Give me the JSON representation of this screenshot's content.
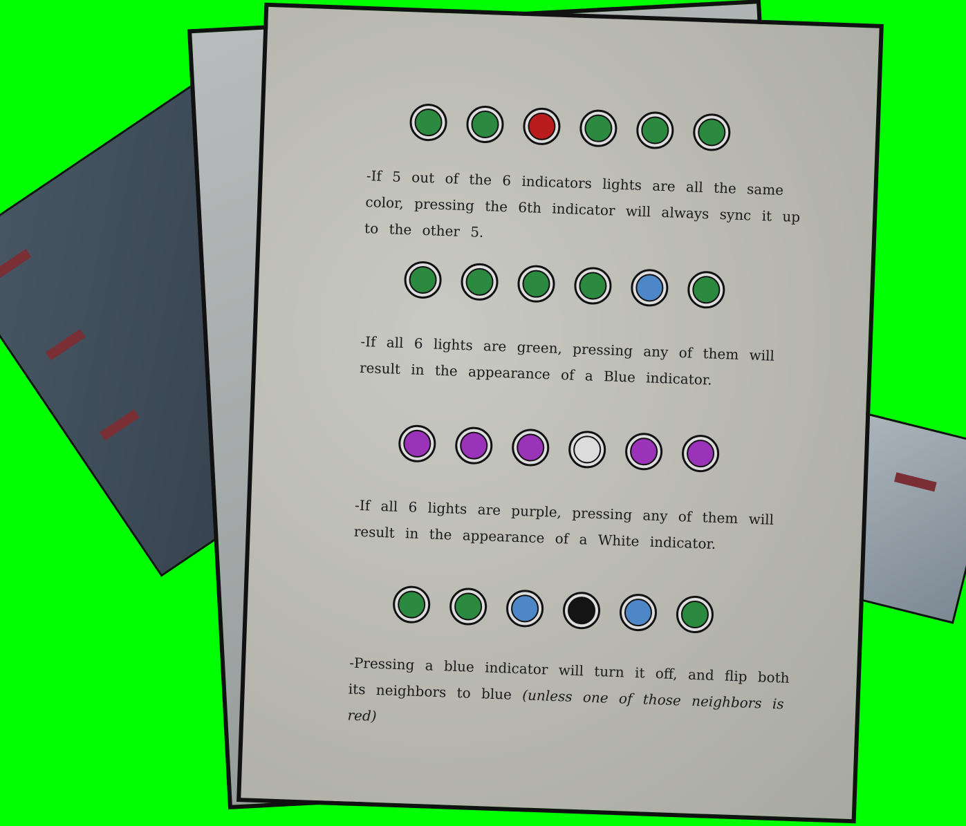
{
  "colors": {
    "green": "#2b8a40",
    "red": "#b81c1c",
    "blue": "#4d87c7",
    "purple": "#9b33b9",
    "white": "#dcdcdc",
    "black": "#141414"
  },
  "rules": [
    {
      "indicators": [
        "green",
        "green",
        "red",
        "green",
        "green",
        "green"
      ],
      "text": "-If 5 out of the 6 indicators lights are all the same color, pressing the 6th indicator will always sync it up to the other 5."
    },
    {
      "indicators": [
        "green",
        "green",
        "green",
        "green",
        "blue",
        "green"
      ],
      "text": "-If all 6 lights are green, pressing any of them will result in the appearance of a Blue indicator."
    },
    {
      "indicators": [
        "purple",
        "purple",
        "purple",
        "white",
        "purple",
        "purple"
      ],
      "text": "-If all 6 lights are purple, pressing any of them will result in the appearance of a White indicator."
    },
    {
      "indicators": [
        "green",
        "green",
        "blue",
        "black",
        "blue",
        "green"
      ],
      "text": "-Pressing a blue indicator will turn it off, and flip both its neighbors to blue",
      "note": "(unless one of those neighbors is red)"
    }
  ]
}
